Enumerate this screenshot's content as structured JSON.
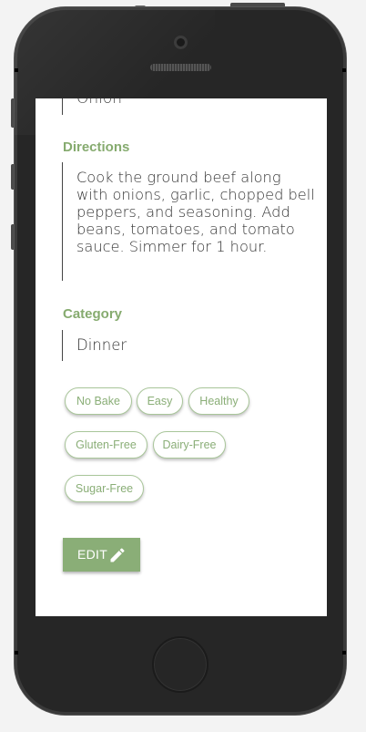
{
  "recipe": {
    "ingredient_tail": "Onion",
    "directions_title": "Directions",
    "directions_text": "Cook the ground beef along with onions, garlic, chopped bell peppers, and seasoning. Add beans, tomatoes, and tomato sauce. Simmer for 1 hour.",
    "category_title": "Category",
    "category_value": "Dinner",
    "tags": [
      "No Bake",
      "Easy",
      "Healthy",
      "Gluten-Free",
      "Dairy-Free",
      "Sugar-Free"
    ],
    "edit_label": "EDIT"
  },
  "icons": {
    "edit": "pencil-icon"
  },
  "colors": {
    "accent": "#8aae77",
    "tag_border": "#a9c69a",
    "phone_body": "#262626"
  }
}
